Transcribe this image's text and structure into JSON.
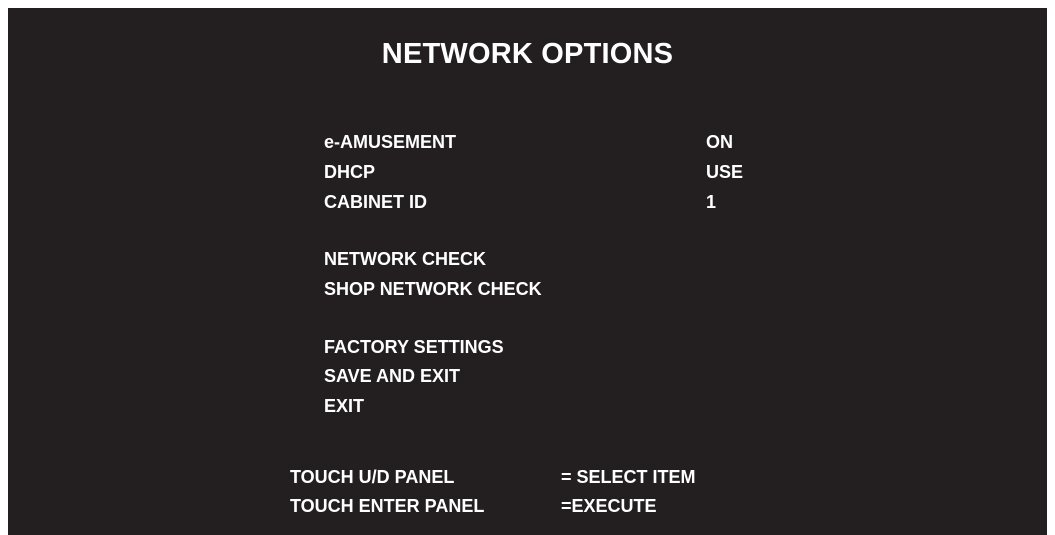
{
  "title": "NETWORK OPTIONS",
  "settings": [
    {
      "label": "e-AMUSEMENT",
      "value": "ON"
    },
    {
      "label": "DHCP",
      "value": "USE"
    },
    {
      "label": "CABINET ID",
      "value": "1"
    }
  ],
  "checks": [
    {
      "label": "NETWORK CHECK"
    },
    {
      "label": "SHOP NETWORK CHECK"
    }
  ],
  "actions": [
    {
      "label": "FACTORY SETTINGS"
    },
    {
      "label": "SAVE AND EXIT"
    },
    {
      "label": "EXIT"
    }
  ],
  "help": [
    {
      "key": "TOUCH U/D PANEL",
      "action": "= SELECT ITEM"
    },
    {
      "key": "TOUCH ENTER PANEL",
      "action": "=EXECUTE"
    }
  ],
  "colors": {
    "background": "#231f20",
    "text": "#ffffff",
    "border": "#ffffff"
  }
}
